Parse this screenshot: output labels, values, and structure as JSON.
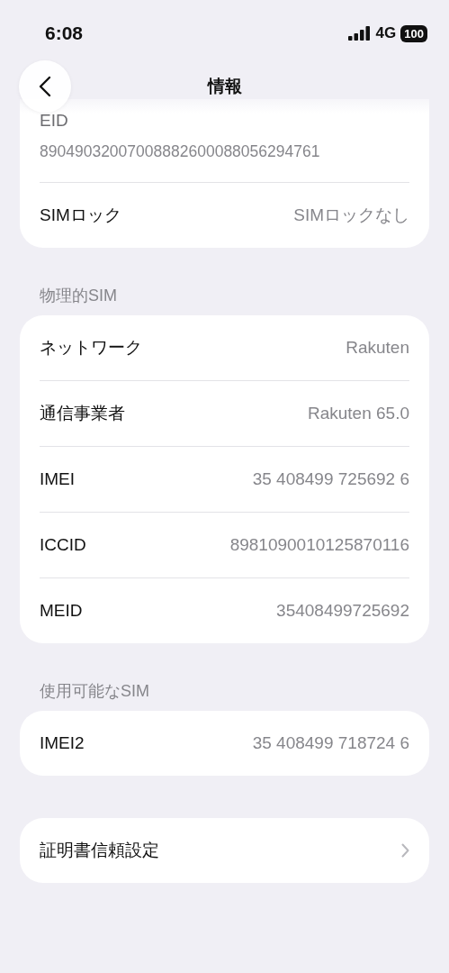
{
  "status_bar": {
    "time": "6:08",
    "network": "4G",
    "battery": "100"
  },
  "header": {
    "title": "情報"
  },
  "groups": [
    {
      "rows": [
        {
          "kind": "stacked",
          "label": "EID",
          "value": "89049032007008882600088056294761"
        },
        {
          "kind": "value",
          "label": "SIMロック",
          "value": "SIMロックなし"
        }
      ]
    },
    {
      "header": "物理的SIM",
      "rows": [
        {
          "kind": "value",
          "label": "ネットワーク",
          "value": "Rakuten"
        },
        {
          "kind": "value",
          "label": "通信事業者",
          "value": "Rakuten 65.0"
        },
        {
          "kind": "value",
          "label": "IMEI",
          "value": "35 408499 725692 6"
        },
        {
          "kind": "value",
          "label": "ICCID",
          "value": "8981090010125870116"
        },
        {
          "kind": "value",
          "label": "MEID",
          "value": "35408499725692"
        }
      ]
    },
    {
      "header": "使用可能なSIM",
      "rows": [
        {
          "kind": "value",
          "label": "IMEI2",
          "value": "35 408499 718724 6"
        }
      ]
    },
    {
      "rows": [
        {
          "kind": "link",
          "label": "証明書信頼設定"
        }
      ]
    }
  ]
}
